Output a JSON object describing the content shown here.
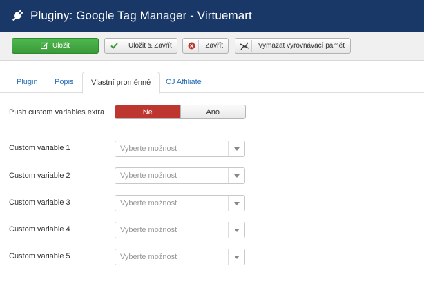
{
  "header": {
    "title": "Pluginy: Google Tag Manager - Virtuemart",
    "icon": "plug-icon"
  },
  "toolbar": {
    "save": "Uložit",
    "save_close": "Uložit & Zavřít",
    "close": "Zavřít",
    "clear_cache": "Vymazat vyrovnávací paměť"
  },
  "tabs": [
    "Plugin",
    "Popis",
    "Vlastní proměnné",
    "CJ Affiliate"
  ],
  "active_tab": "Vlastní proměnné",
  "fields": {
    "push_label": "Push custom variables extra",
    "push_options": {
      "no": "Ne",
      "yes": "Ano",
      "selected": "Ne"
    },
    "variables": [
      {
        "label": "Custom variable 1",
        "placeholder": "Vyberte možnost"
      },
      {
        "label": "Custom variable 2",
        "placeholder": "Vyberte možnost"
      },
      {
        "label": "Custom variable 3",
        "placeholder": "Vyberte možnost"
      },
      {
        "label": "Custom variable 4",
        "placeholder": "Vyberte možnost"
      },
      {
        "label": "Custom variable 5",
        "placeholder": "Vyberte možnost"
      }
    ]
  },
  "colors": {
    "header_bg": "#1a3867",
    "save_green": "#46a546",
    "toggle_red": "#bd362f",
    "link_blue": "#2a6fb6"
  }
}
